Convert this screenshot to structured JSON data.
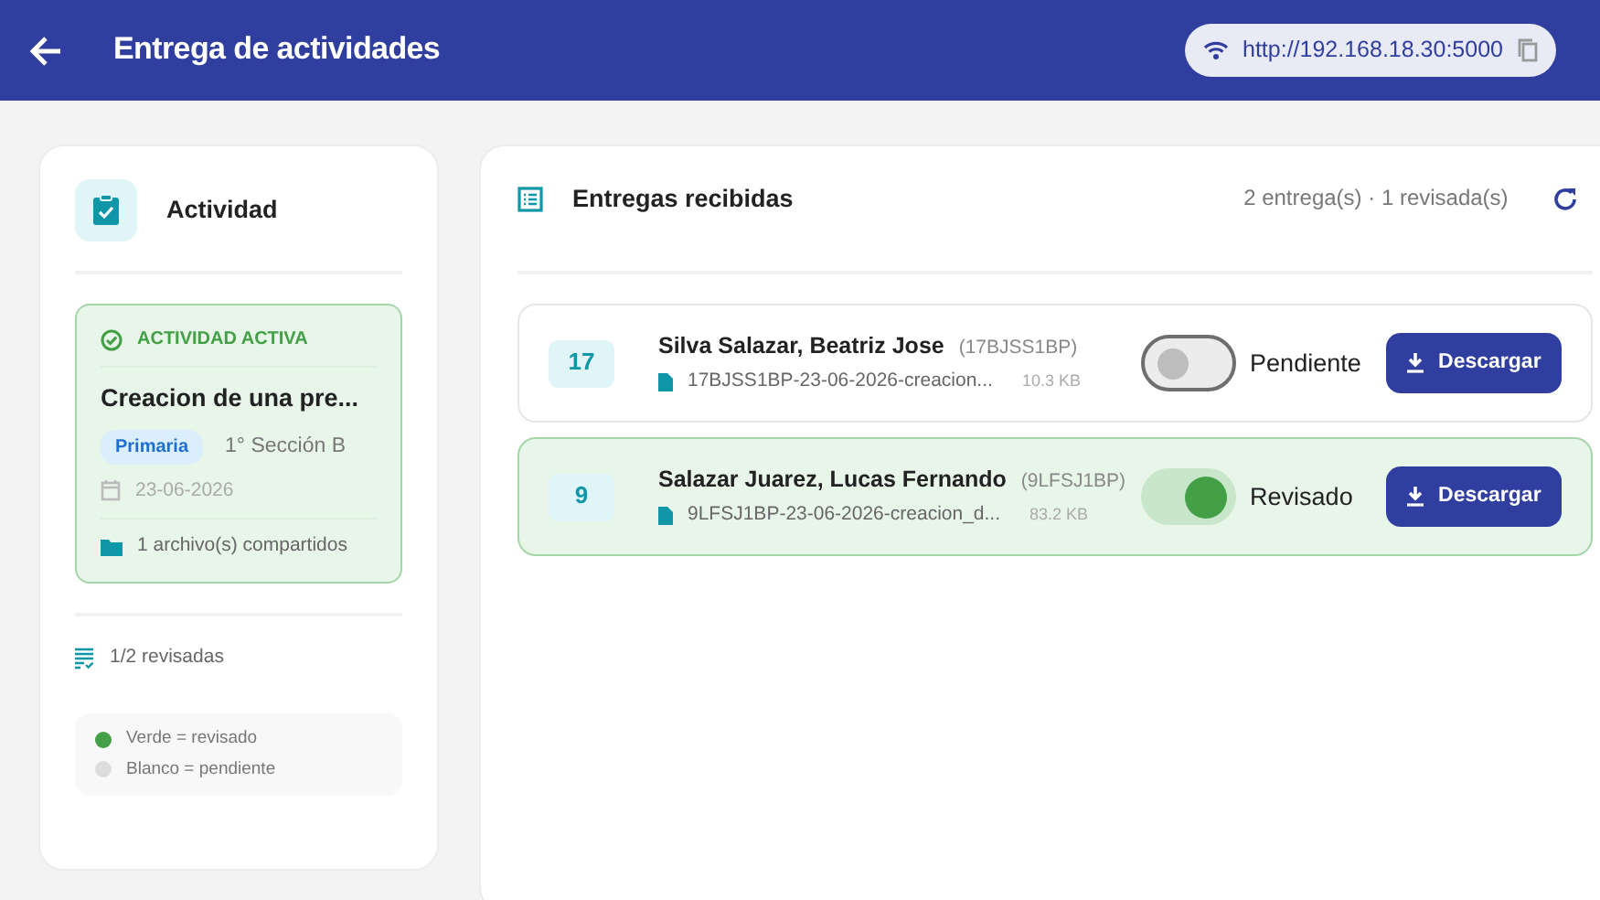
{
  "header": {
    "title": "Entrega de actividades",
    "server_url": "http://192.168.18.30:5000"
  },
  "activity_panel": {
    "title": "Actividad",
    "status": "ACTIVIDAD ACTIVA",
    "activity_name": "Creacion de una pre...",
    "level_tag": "Primaria",
    "section": "1° Sección B",
    "date": "23-06-2026",
    "shared_files": "1 archivo(s) compartidos",
    "reviewed_count": "1/2 revisadas",
    "legend": [
      {
        "label": "Verde = revisado",
        "color": "#43a047"
      },
      {
        "label": "Blanco = pendiente",
        "color": "#dddddd"
      }
    ]
  },
  "submissions": {
    "title": "Entregas recibidas",
    "summary": "2 entrega(s) · 1 revisada(s)",
    "items": [
      {
        "number": "17",
        "name": "Silva Salazar, Beatriz Jose",
        "code": "(17BJSS1BP)",
        "file": "17BJSS1BP-23-06-2026-creacion...",
        "size": "10.3 KB",
        "reviewed": false,
        "status": "Pendiente",
        "button": "Descargar"
      },
      {
        "number": "9",
        "name": "Salazar Juarez, Lucas Fernando",
        "code": "(9LFSJ1BP)",
        "file": "9LFSJ1BP-23-06-2026-creacion_d...",
        "size": "83.2 KB",
        "reviewed": true,
        "status": "Revisado",
        "button": "Descargar"
      }
    ]
  }
}
